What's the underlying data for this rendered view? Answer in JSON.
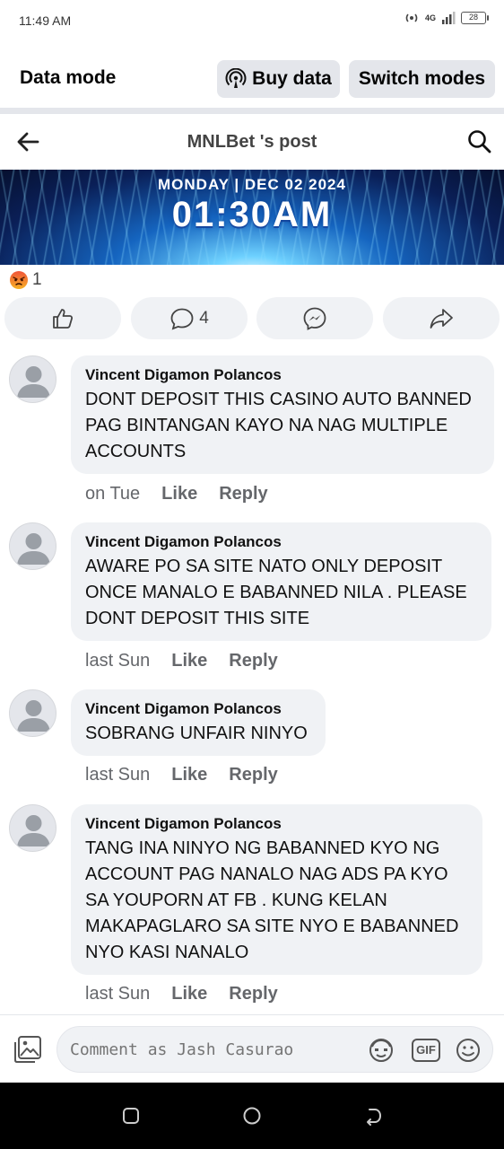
{
  "status_bar": {
    "time": "11:49 AM",
    "network": "4G",
    "battery": "28"
  },
  "data_mode": {
    "title": "Data mode",
    "buy_label": "Buy data",
    "switch_label": "Switch modes"
  },
  "post_header": {
    "title": "MNLBet 's post"
  },
  "banner": {
    "date_text": "MONDAY | DEC 02 2024",
    "time_text": "01:30AM"
  },
  "reactions": {
    "count": "1",
    "icon": "angry-face-icon"
  },
  "actions": {
    "comment_count": "4"
  },
  "comments": [
    {
      "author": "Vincent Digamon Polancos",
      "text": "DONT DEPOSIT THIS CASINO AUTO BANNED PAG BINTANGAN KAYO NA NAG MULTIPLE ACCOUNTS",
      "time": "on Tue",
      "like": "Like",
      "reply": "Reply"
    },
    {
      "author": "Vincent Digamon Polancos",
      "text": "AWARE PO SA SITE NATO ONLY DEPOSIT ONCE MANALO E BABANNED NILA . PLEASE DONT DEPOSIT THIS SITE",
      "time": "last Sun",
      "like": "Like",
      "reply": "Reply"
    },
    {
      "author": "Vincent Digamon Polancos",
      "text": "SOBRANG UNFAIR NINYO",
      "time": "last Sun",
      "like": "Like",
      "reply": "Reply"
    },
    {
      "author": "Vincent Digamon Polancos",
      "text": "TANG INA NINYO NG BABANNED KYO NG ACCOUNT PAG NANALO NAG ADS PA KYO SA YOUPORN AT FB . KUNG KELAN MAKAPAGLARO SA SITE NYO E BABANNED NYO KASI NANALO",
      "time": "last Sun",
      "like": "Like",
      "reply": "Reply"
    }
  ],
  "composer": {
    "placeholder": "Comment as Jash Casurao",
    "gif_label": "GIF"
  },
  "colors": {
    "pill_bg": "#e4e6eb",
    "bubble_bg": "#f0f2f5",
    "meta_text": "#65676b",
    "nav_bg": "#000000"
  }
}
